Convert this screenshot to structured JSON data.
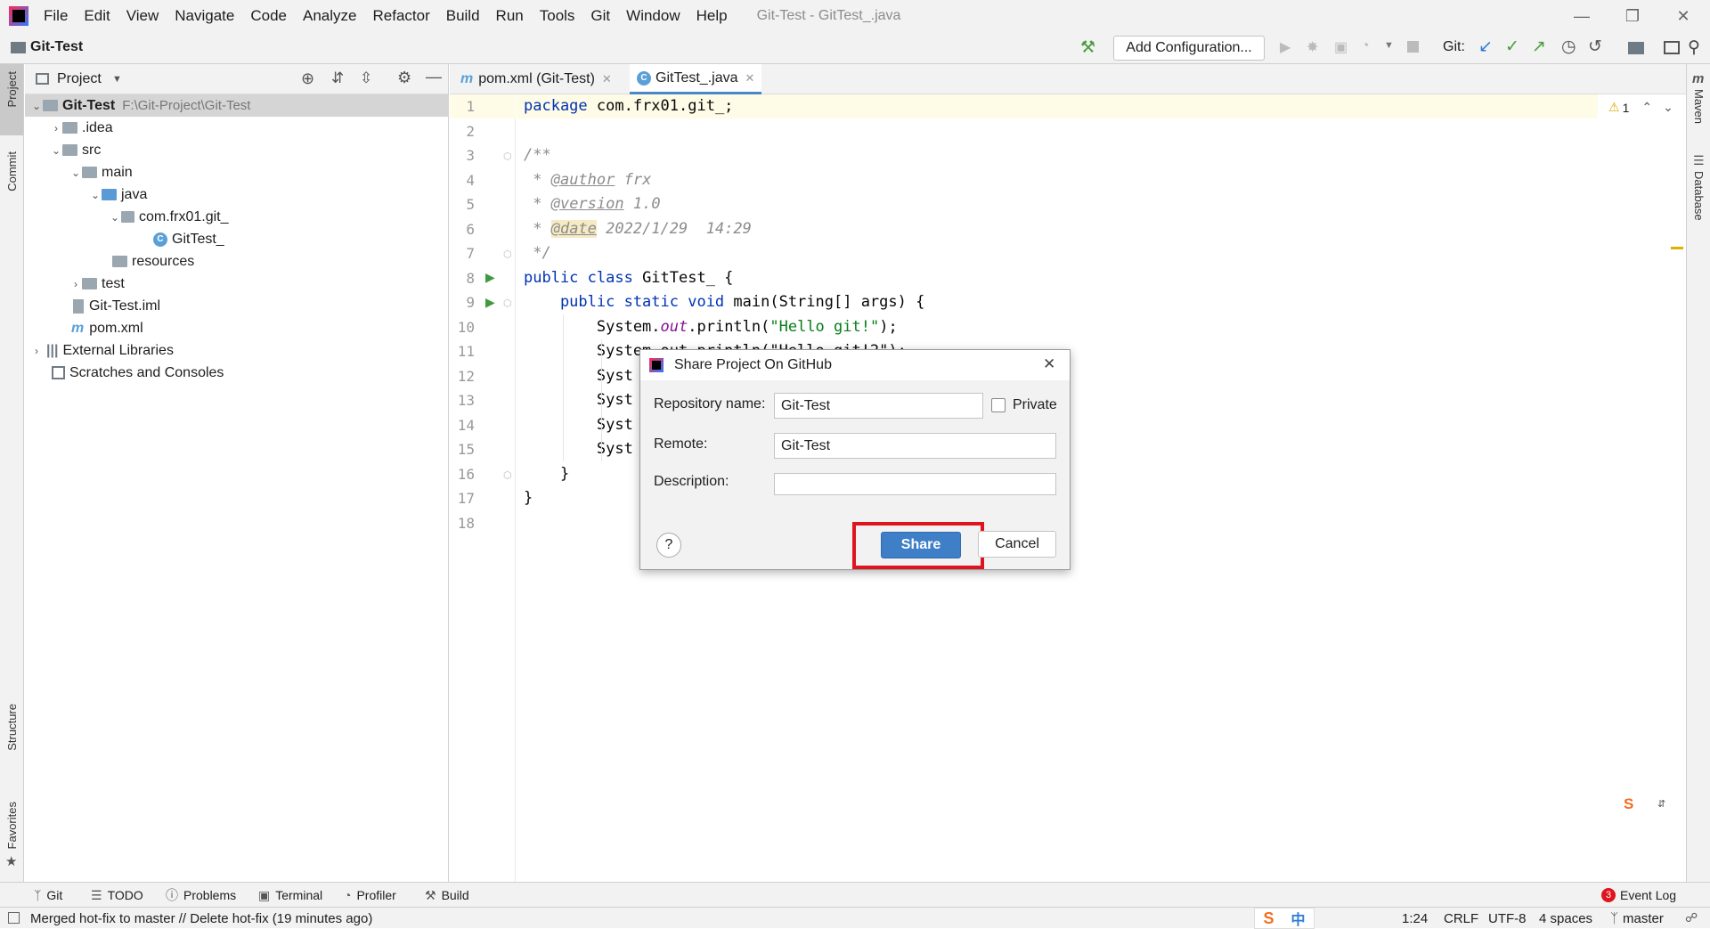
{
  "app": {
    "window_title": "Git-Test - GitTest_.java",
    "menu": [
      "File",
      "Edit",
      "View",
      "Navigate",
      "Code",
      "Analyze",
      "Refactor",
      "Build",
      "Run",
      "Tools",
      "Git",
      "Window",
      "Help"
    ]
  },
  "navbar": {
    "project": "Git-Test",
    "add_configuration": "Add Configuration...",
    "git_label": "Git:"
  },
  "left_strip": {
    "project": "Project",
    "commit": "Commit",
    "structure": "Structure",
    "favorites": "Favorites"
  },
  "right_strip": {
    "maven": "Maven",
    "database": "Database"
  },
  "project_panel": {
    "title": "Project",
    "tree": [
      {
        "label": "Git-Test",
        "path": "F:\\Git-Project\\Git-Test"
      },
      {
        "label": ".idea"
      },
      {
        "label": "src"
      },
      {
        "label": "main"
      },
      {
        "label": "java"
      },
      {
        "label": "com.frx01.git_"
      },
      {
        "label": "GitTest_"
      },
      {
        "label": "resources"
      },
      {
        "label": "test"
      },
      {
        "label": "Git-Test.iml"
      },
      {
        "label": "pom.xml"
      },
      {
        "label": "External Libraries"
      },
      {
        "label": "Scratches and Consoles"
      }
    ]
  },
  "tabs": [
    {
      "label": "pom.xml (Git-Test)"
    },
    {
      "label": "GitTest_.java"
    }
  ],
  "editor": {
    "warning_count": "1",
    "line_numbers": [
      "1",
      "2",
      "3",
      "4",
      "5",
      "6",
      "7",
      "8",
      "9",
      "10",
      "11",
      "12",
      "13",
      "14",
      "15",
      "16",
      "17",
      "18"
    ],
    "l1": {
      "kw": "package",
      "rest": " com.frx01.git_;"
    },
    "l3": "/**",
    "l4": {
      "star": " * ",
      "tag": "@author",
      "rest": " frx"
    },
    "l5": {
      "star": " * ",
      "tag": "@version",
      "rest": " 1.0"
    },
    "l6": {
      "star": " * ",
      "tag": "@date",
      "rest": " 2022/1/29  14:29"
    },
    "l7": " */",
    "l8": {
      "kw": "public class",
      "rest": " GitTest_ {"
    },
    "l9": {
      "kw": "    public static void",
      "rest": " main(String[] args) {"
    },
    "l10": {
      "a": "        System.",
      "f": "out",
      "b": ".println(",
      "s": "\"Hello git!\"",
      "c": ");"
    },
    "l11": "        System.out.println(\"Hello git!2\");",
    "l12": "        Syst",
    "l13": "        Syst",
    "l14": "        Syst",
    "l15": "        Syst",
    "l16": "    }",
    "l17": "}"
  },
  "dialog": {
    "title": "Share Project On GitHub",
    "repo_label": "Repository name:",
    "repo_value": "Git-Test",
    "private_label": "Private",
    "remote_label": "Remote:",
    "remote_value": "Git-Test",
    "description_label": "Description:",
    "description_value": "",
    "help": "?",
    "share": "Share",
    "cancel": "Cancel"
  },
  "bottom_tools": [
    "Git",
    "TODO",
    "Problems",
    "Terminal",
    "Profiler",
    "Build"
  ],
  "event_log": {
    "count": "3",
    "label": "Event Log"
  },
  "status": {
    "message": "Merged hot-fix to master // Delete hot-fix (19 minutes ago)",
    "ime": "中",
    "position": "1:24",
    "line_sep": "CRLF",
    "encoding": "UTF-8",
    "indent": "4 spaces",
    "branch": "master"
  },
  "colors": {
    "accent": "#4a88c7",
    "highlight_box": "#e0141e",
    "share_button": "#3f7fc8"
  }
}
